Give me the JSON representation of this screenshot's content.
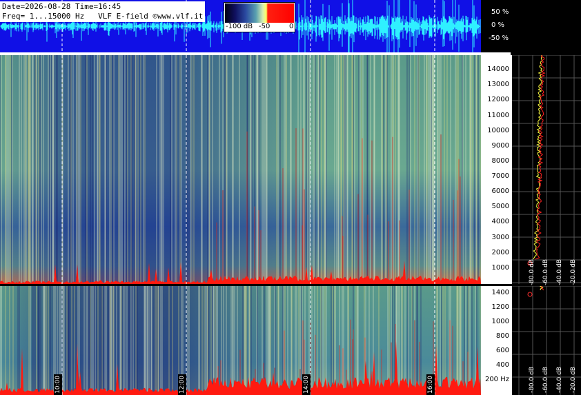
{
  "info": {
    "line1": "Date=2026-08-28 Time=16:45",
    "line2": "Freq= 1...15000 Hz   VLF E-field ©www.vlf.it"
  },
  "colorbar": {
    "labels": [
      "-100 dB",
      "-50",
      "0"
    ]
  },
  "waveform": {
    "pct_labels": [
      "50 %",
      "0 %",
      "-50 %"
    ]
  },
  "chart_data": [
    {
      "type": "heatmap",
      "title": "",
      "xlabel": "",
      "ylabel": "",
      "y_ticks": [
        "14000",
        "13000",
        "12000",
        "11000",
        "10000",
        "9000",
        "8000",
        "7000",
        "6000",
        "5000",
        "4000",
        "3000",
        "2000",
        "1000"
      ],
      "ylim": [
        0,
        15000
      ],
      "x_ticks": [
        "10:00",
        "12:00",
        "14:00",
        "16:00"
      ],
      "colorscale_db": [
        -100,
        0
      ]
    },
    {
      "type": "heatmap",
      "title": "",
      "y_ticks": [
        "1400",
        "1200",
        "1000",
        "800",
        "600",
        "400",
        "200 Hz"
      ],
      "ylim": [
        0,
        1500
      ],
      "x_ticks": [
        "10:00",
        "12:00",
        "14:00",
        "16:00"
      ]
    },
    {
      "type": "line",
      "title": "",
      "x_ticks": [
        "-20.0 dB",
        "-40.0 dB",
        "-60.0 dB",
        "-80.0 dB"
      ]
    },
    {
      "type": "line",
      "title": "",
      "x_ticks": [
        "-20.0 dB",
        "-40.0 dB",
        "-60.0 dB",
        "-80.0 dB"
      ]
    }
  ]
}
